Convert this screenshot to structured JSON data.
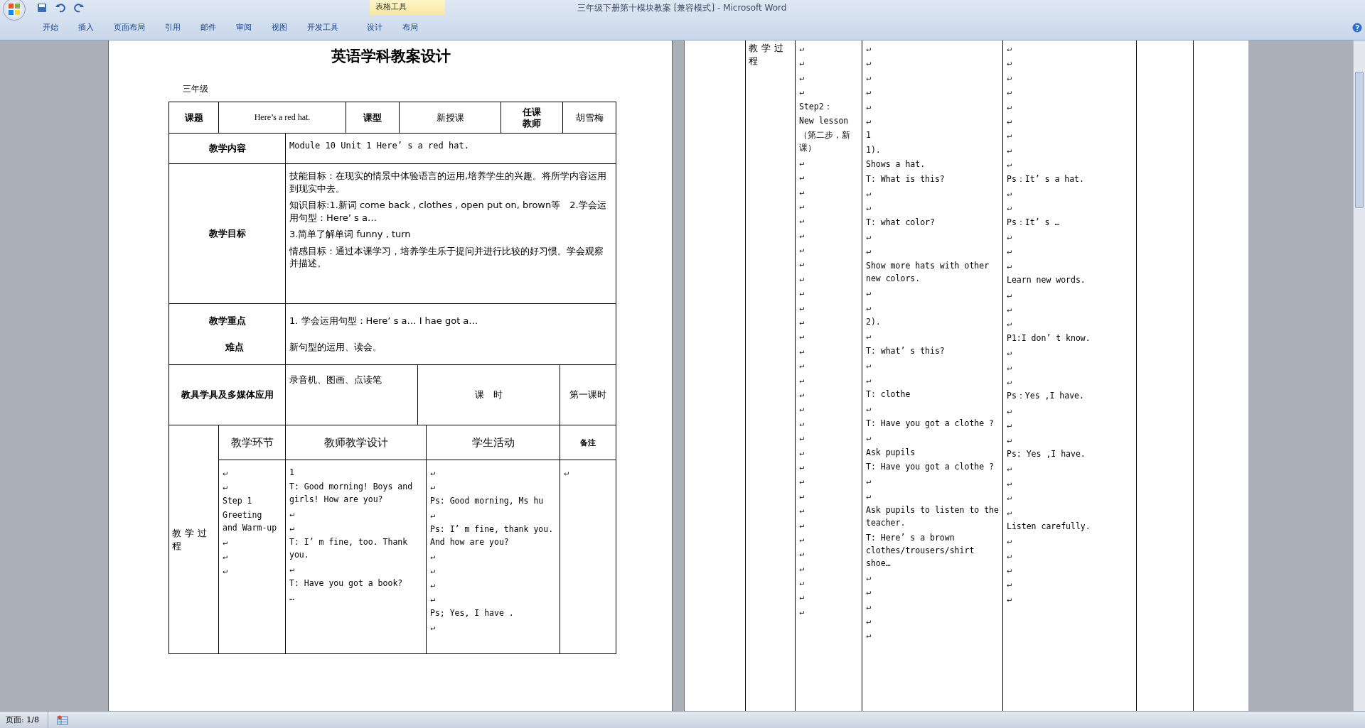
{
  "window": {
    "title": "三年级下册第十模块教案 [兼容模式] - Microsoft Word",
    "contextual_group": "表格工具"
  },
  "ribbon_tabs": [
    {
      "label": "开始",
      "selected": false
    },
    {
      "label": "插入",
      "selected": false
    },
    {
      "label": "页面布局",
      "selected": false
    },
    {
      "label": "引用",
      "selected": false
    },
    {
      "label": "邮件",
      "selected": false
    },
    {
      "label": "审阅",
      "selected": false
    },
    {
      "label": "视图",
      "selected": false
    },
    {
      "label": "开发工具",
      "selected": false
    },
    {
      "label": "设计",
      "selected": false
    },
    {
      "label": "布局",
      "selected": false
    }
  ],
  "left_page": {
    "title": "英语学科教案设计",
    "grade": "三年级",
    "topic_label": "课题",
    "topic": "Here’s a red hat.",
    "type_label": "课型",
    "type": "新授课",
    "teacher_label": [
      "任课",
      "教师"
    ],
    "teacher": "胡雪梅",
    "content_label": "教学内容",
    "content": "Module 10 Unit 1 Here’ s a red hat.",
    "goals_label": "教学目标",
    "goals": [
      "技能目标：在现实的情景中体验语言的运用,培养学生的兴趣。将所学内容运用到现实中去。",
      "知识目标:1.新词 come back , clothes , open put on, brown等　2.学会运用句型：Here’ s a…",
      "3.简单了解单词  funny ,  turn",
      "情感目标：通过本课学习，培养学生乐于提问并进行比较的好习惯。学会观察并描述。"
    ],
    "key_label": "教学重点",
    "key": "1. 学会运用句型：Here’ s a…  I hae got a…",
    "difficulty_label": "难点",
    "difficulty": "新句型的运用、读会。",
    "media_label": "教具学具及多媒体应用",
    "media": "录音机、图画、点读笔",
    "period_label": "课　时",
    "period": "第一课时",
    "process_label": "教学过程",
    "headers": [
      "教学环节",
      "教师教学设计",
      "学生活动",
      "备注"
    ],
    "columns": [
      [
        "↵",
        "↵",
        "Step 1",
        "Greeting and Warm-up",
        "↵",
        "↵",
        "↵"
      ],
      [
        "1",
        "T: Good morning! Boys and girls! How are you?",
        "↵",
        "↵",
        "T: I’ m fine, too. Thank you.",
        "↵",
        "T: Have you got a book?",
        "…"
      ],
      [
        "↵",
        "↵",
        "Ps: Good morning,  Ms hu",
        "↵",
        "Ps: I’ m fine, thank you. And how are you?",
        "↵",
        "↵",
        "↵",
        "↵",
        "Ps;  Yes, I have .",
        "↵"
      ],
      [
        "↵"
      ]
    ]
  },
  "right_page": {
    "process_label": "教学过程",
    "columns": [
      [
        "↵",
        "↵",
        "↵",
        "↵",
        "Step2：",
        "New lesson",
        "（第二步，新课）",
        "↵",
        "↵",
        "↵",
        "↵",
        "↵",
        "↵",
        "↵",
        "↵",
        "↵",
        "↵",
        "↵",
        "↵",
        "↵",
        "↵",
        "↵",
        "↵",
        "↵",
        "↵",
        "↵",
        "↵",
        "↵",
        "↵",
        "↵",
        "↵",
        "↵",
        "↵",
        "↵",
        "↵",
        "↵",
        "↵",
        "↵",
        "↵"
      ],
      [
        "↵",
        "↵",
        "↵",
        "↵",
        "↵",
        "↵",
        "1",
        "1).",
        "Shows a hat.",
        "T: What is this?",
        "↵",
        "↵",
        "T: what color?",
        "↵",
        "↵",
        "Show more hats with other new colors.",
        "↵",
        "↵",
        "2).",
        "↵",
        "T: what’ s this?",
        "↵",
        "↵",
        "T: clothe",
        "↵",
        "T: Have you got a clothe ?",
        "↵",
        "Ask pupils",
        "T: Have you got a clothe ?",
        "↵",
        "↵",
        "Ask pupils to listen to the  teacher.",
        "T: Here’ s a brown clothes/trousers/shirt shoe…",
        "↵",
        "↵",
        "↵",
        "↵",
        "↵"
      ],
      [
        "↵",
        "↵",
        "↵",
        "↵",
        "↵",
        "↵",
        "↵",
        "↵",
        "↵",
        "Ps：It’ s a hat.",
        "↵",
        "↵",
        "Ps：It’ s …",
        "↵",
        "↵",
        "↵",
        "Learn  new words.",
        "↵",
        "↵",
        "↵",
        "P1:I don’ t know.",
        "↵",
        "↵",
        "↵",
        "Ps：Yes ,I have.",
        "↵",
        "↵",
        "↵",
        "Ps: Yes ,I have.",
        "↵",
        "↵",
        "↵",
        "↵",
        "Listen carefully.",
        "↵",
        "↵",
        "↵",
        "↵",
        "↵"
      ],
      []
    ]
  },
  "status_bar": {
    "page": "页面: 1/8"
  }
}
